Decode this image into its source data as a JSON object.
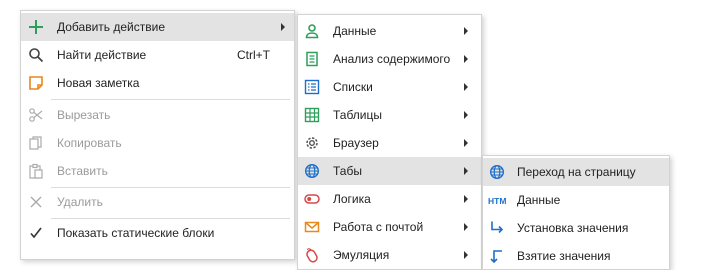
{
  "main_menu": {
    "items": [
      {
        "label": "Добавить действие",
        "icon": "plus-icon",
        "submenu": true,
        "highlighted": true
      },
      {
        "label": "Найти действие",
        "shortcut": "Ctrl+T",
        "icon": "search-icon"
      },
      {
        "label": "Новая заметка",
        "icon": "note-icon"
      },
      {
        "label": "Вырезать",
        "icon": "scissors-icon",
        "disabled": true
      },
      {
        "label": "Копировать",
        "icon": "copy-icon",
        "disabled": true
      },
      {
        "label": "Вставить",
        "icon": "paste-icon",
        "disabled": true
      },
      {
        "label": "Удалить",
        "icon": "close-icon",
        "disabled": true
      },
      {
        "label": "Показать статические блоки",
        "icon": "checkmark-icon",
        "checked": true
      }
    ]
  },
  "add_action_submenu": {
    "items": [
      {
        "label": "Данные",
        "icon": "user-icon",
        "submenu": true
      },
      {
        "label": "Анализ содержимого",
        "icon": "document-icon",
        "submenu": true
      },
      {
        "label": "Списки",
        "icon": "list-icon",
        "submenu": true
      },
      {
        "label": "Таблицы",
        "icon": "table-icon",
        "submenu": true
      },
      {
        "label": "Браузер",
        "icon": "gear-icon",
        "submenu": true
      },
      {
        "label": "Табы",
        "icon": "globe-icon",
        "submenu": true,
        "highlighted": true
      },
      {
        "label": "Логика",
        "icon": "toggle-icon",
        "submenu": true
      },
      {
        "label": "Работа с почтой",
        "icon": "mail-icon",
        "submenu": true
      },
      {
        "label": "Эмуляция",
        "icon": "mouse-icon",
        "submenu": true
      }
    ]
  },
  "tabs_submenu": {
    "items": [
      {
        "label": "Переход на страницу",
        "icon": "globe-icon",
        "highlighted": true
      },
      {
        "label": "Данные",
        "icon": "htm-icon"
      },
      {
        "label": "Установка значения",
        "icon": "arrow-down-right-icon"
      },
      {
        "label": "Взятие значения",
        "icon": "arrow-left-down-icon"
      }
    ]
  },
  "htm_icon_text": "HTM",
  "colors": {
    "accent_green": "#2e9e5b",
    "accent_blue": "#1e6fc9",
    "accent_orange": "#e8891d",
    "accent_red": "#d64848",
    "highlight": "#e3e3e3",
    "disabled_text": "#9a9a9a"
  }
}
